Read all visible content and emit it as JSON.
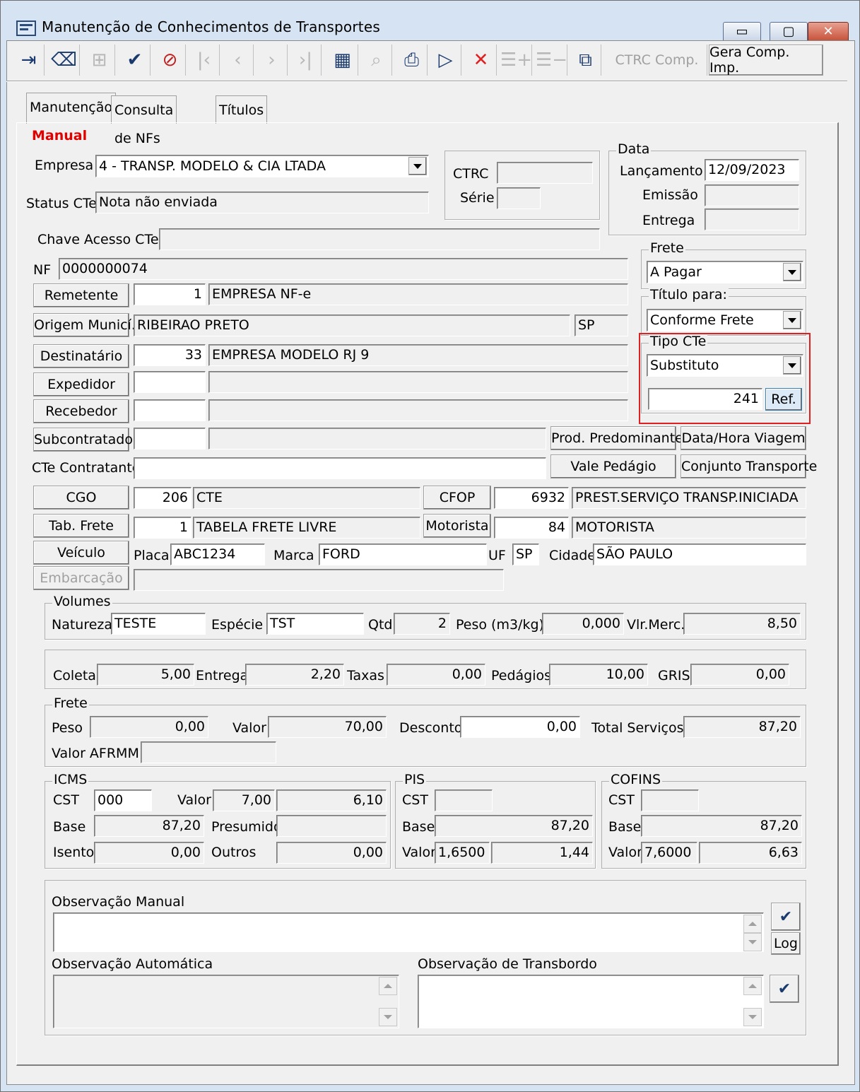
{
  "window": {
    "title": "Manutenção de Conhecimentos de Transportes",
    "min": "▭",
    "max": "▢",
    "close": "✕"
  },
  "toolbar": {
    "ctrc_comp": "CTRC Comp.",
    "gera_comp": "Gera Comp. Imp."
  },
  "tabs": [
    "Manutenção",
    "Consulta de NFs",
    "Títulos"
  ],
  "mode": "Manual",
  "empresa": {
    "label": "Empresa",
    "value": "4 - TRANSP. MODELO & CIA LTADA"
  },
  "status": {
    "label": "Status CTe",
    "value": "Nota não enviada"
  },
  "ctrc": {
    "label": "CTRC",
    "value": "",
    "serie_label": "Série",
    "serie": ""
  },
  "data": {
    "group": "Data",
    "lanc_label": "Lançamento",
    "lanc": "12/09/2023",
    "emissao_label": "Emissão",
    "emissao": "",
    "entrega_label": "Entrega",
    "entrega": ""
  },
  "chave": {
    "label": "Chave Acesso CTe",
    "value": ""
  },
  "nf": {
    "label": "NF",
    "value": "0000000074"
  },
  "remetente": {
    "btn": "Remetente",
    "code": "1",
    "name": "EMPRESA NF-e"
  },
  "origem": {
    "btn": "Origem Municí.",
    "city": "RIBEIRAO PRETO",
    "uf": "SP"
  },
  "destinatario": {
    "btn": "Destinatário",
    "code": "33",
    "name": "EMPRESA MODELO RJ 9"
  },
  "expedidor": {
    "btn": "Expedidor",
    "code": "",
    "name": ""
  },
  "recebedor": {
    "btn": "Recebedor",
    "code": "",
    "name": ""
  },
  "subcontratado": {
    "btn": "Subcontratado",
    "code": "",
    "name": ""
  },
  "cte_contratante": {
    "label": "CTe Contratante",
    "value": ""
  },
  "frete_grp": {
    "label": "Frete",
    "value": "A Pagar"
  },
  "titulo_grp": {
    "label": "Título para:",
    "value": "Conforme Frete"
  },
  "tipo_cte": {
    "label": "Tipo CTe",
    "value": "Substituto",
    "ref_value": "241",
    "ref_btn": "Ref."
  },
  "buttons": {
    "prod": "Prod. Predominante",
    "data_hora": "Data/Hora Viagem",
    "vale": "Vale Pedágio",
    "conjunto": "Conjunto Transporte"
  },
  "cgo": {
    "btn": "CGO",
    "code": "206",
    "name": "CTE"
  },
  "cfop": {
    "btn": "CFOP",
    "code": "6932",
    "name": "PREST.SERVIÇO TRANSP.INICIADA"
  },
  "tab_frete": {
    "btn": "Tab. Frete",
    "code": "1",
    "name": "TABELA FRETE LIVRE"
  },
  "motorista": {
    "btn": "Motorista",
    "code": "84",
    "name": "MOTORISTA"
  },
  "veiculo": {
    "btn": "Veículo",
    "placa_label": "Placa",
    "placa": "ABC1234",
    "marca_label": "Marca",
    "marca": "FORD",
    "uf_label": "UF",
    "uf": "SP",
    "cidade_label": "Cidade",
    "cidade": "SÃO PAULO"
  },
  "embarcacao": {
    "btn": "Embarcação",
    "value": ""
  },
  "volumes": {
    "group": "Volumes",
    "natureza_label": "Natureza",
    "natureza": "TESTE",
    "especie_label": "Espécie",
    "especie": "TST",
    "qtd_label": "Qtd",
    "qtd": "2",
    "peso_label": "Peso (m3/kg)",
    "peso": "0,000",
    "vlr_label": "Vlr.Merc.",
    "vlr": "8,50"
  },
  "taxas": {
    "coleta_label": "Coleta",
    "coleta": "5,00",
    "entrega_label": "Entrega",
    "entrega": "2,20",
    "taxas_label": "Taxas",
    "taxas": "0,00",
    "pedagios_label": "Pedágios",
    "pedagios": "10,00",
    "gris_label": "GRIS",
    "gris": "0,00"
  },
  "frete": {
    "group": "Frete",
    "peso_label": "Peso",
    "peso": "0,00",
    "valor_label": "Valor",
    "valor": "70,00",
    "desconto_label": "Desconto",
    "desconto": "0,00",
    "total_label": "Total Serviços",
    "total": "87,20",
    "afrmm_label": "Valor AFRMM",
    "afrmm": ""
  },
  "icms": {
    "group": "ICMS",
    "cst_label": "CST",
    "cst": "000",
    "valor_label": "Valor",
    "aliq": "7,00",
    "valor": "6,10",
    "base_label": "Base",
    "base": "87,20",
    "presumido_label": "Presumido",
    "presumido": "",
    "isento_label": "Isento",
    "isento": "0,00",
    "outros_label": "Outros",
    "outros": "0,00"
  },
  "pis": {
    "group": "PIS",
    "cst_label": "CST",
    "cst": "",
    "base_label": "Base",
    "base": "87,20",
    "valor_label": "Valor",
    "aliq": "1,6500",
    "valor": "1,44"
  },
  "cofins": {
    "group": "COFINS",
    "cst_label": "CST",
    "cst": "",
    "base_label": "Base",
    "base": "87,20",
    "valor_label": "Valor",
    "aliq": "7,6000",
    "valor": "6,63"
  },
  "obs": {
    "manual_label": "Observação Manual",
    "auto_label": "Observação Automática",
    "transbordo_label": "Observação de Transbordo",
    "log_btn": "Log"
  }
}
